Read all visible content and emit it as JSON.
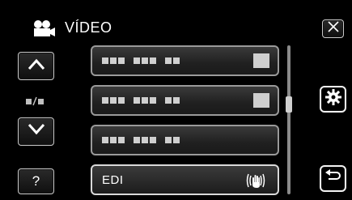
{
  "header": {
    "title": "VÍDEO",
    "mode_icon": "video-camera-icon"
  },
  "nav": {
    "up_icon": "chevron-up-icon",
    "down_icon": "chevron-down-icon",
    "page_indicator_icon": "page-indicator-icon",
    "help_label": "?"
  },
  "actions": {
    "close_icon": "close-icon",
    "settings_icon": "gear-icon",
    "back_icon": "return-icon"
  },
  "menu": {
    "items": [
      {
        "label": "",
        "icon": "redacted-text-placeholder"
      },
      {
        "label": "",
        "icon": "redacted-text-placeholder"
      },
      {
        "label": "",
        "icon": "redacted-text-placeholder"
      },
      {
        "label": "EDI",
        "icon": "stabilizer-hand-icon"
      }
    ]
  },
  "colors": {
    "background": "#000000",
    "row_border": "#9a9a9a",
    "text": "#ffffff"
  }
}
